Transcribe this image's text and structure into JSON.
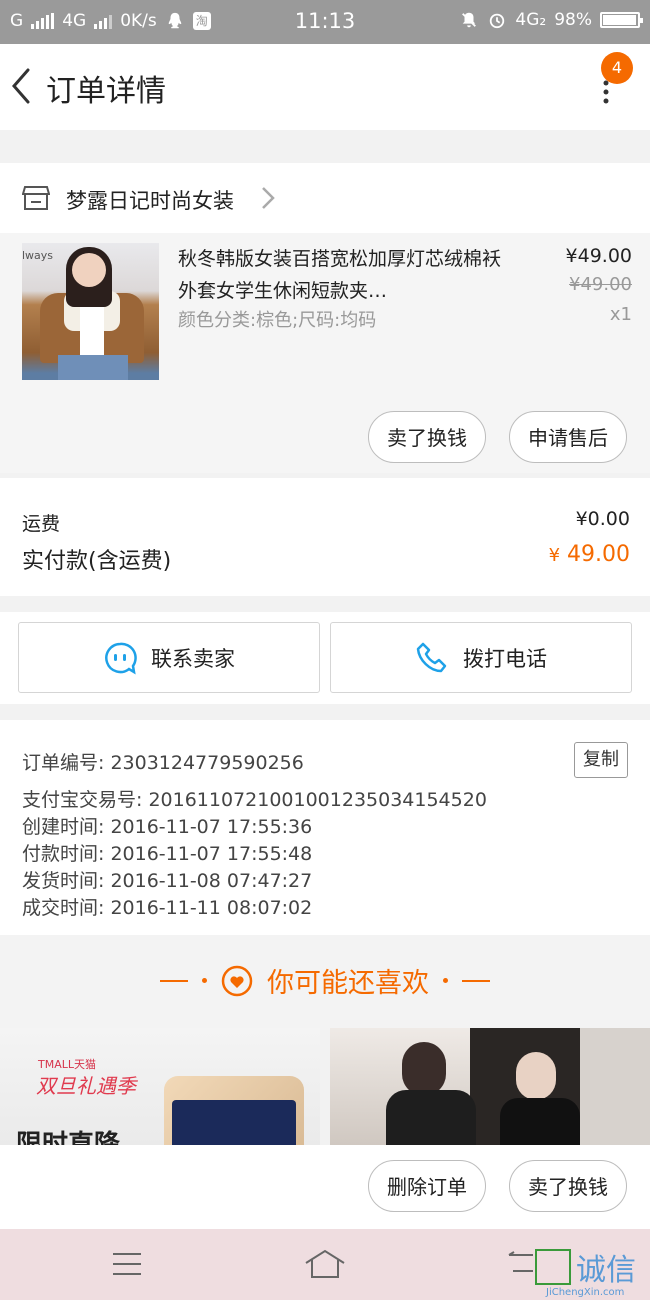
{
  "status_bar": {
    "network_left": "G",
    "network_4g": "4G",
    "speed": "0K/s",
    "time": "11:13",
    "network_right": "4G₂",
    "battery": "98%"
  },
  "header": {
    "title": "订单详情",
    "badge_count": "4"
  },
  "shop": {
    "name": "梦露日记时尚女装"
  },
  "product": {
    "title": "秋冬韩版女装百搭宽松加厚灯芯绒棉袄外套女学生休闲短款夹…",
    "spec": "颜色分类:棕色;尺码:均码",
    "price": "¥49.00",
    "original_price": "¥49.00",
    "quantity": "x1",
    "thumb_text": "lways"
  },
  "product_actions": {
    "sell_label": "卖了换钱",
    "after_sale_label": "申请售后"
  },
  "fees": {
    "shipping_label": "运费",
    "shipping_value": "¥0.00",
    "paid_label": "实付款(含运费)",
    "paid_currency": "¥",
    "paid_value": "49.00"
  },
  "contact": {
    "seller_label": "联系卖家",
    "call_label": "拨打电话"
  },
  "order_info": {
    "order_no": "订单编号: 2303124779590256",
    "copy_label": "复制",
    "alipay_no": "支付宝交易号: 2016110721001001235034154520",
    "created": "创建时间: 2016-11-07  17:55:36",
    "paid": "付款时间: 2016-11-07  17:55:48",
    "shipped": "发货时间: 2016-11-08  07:47:27",
    "completed": "成交时间: 2016-11-11  08:07:02"
  },
  "recommend": {
    "title": "你可能还喜欢",
    "card1_brand": "TMALL天猫",
    "card1_promo": "双旦礼遇季",
    "card1_headline": "限时直降"
  },
  "bottom_actions": {
    "delete_label": "删除订单",
    "sell_label": "卖了换钱"
  },
  "watermark": {
    "text": "诚信",
    "url": "JiChengXin.com"
  },
  "colors": {
    "accent": "#f56a00",
    "icon_blue": "#1ea1e8"
  }
}
